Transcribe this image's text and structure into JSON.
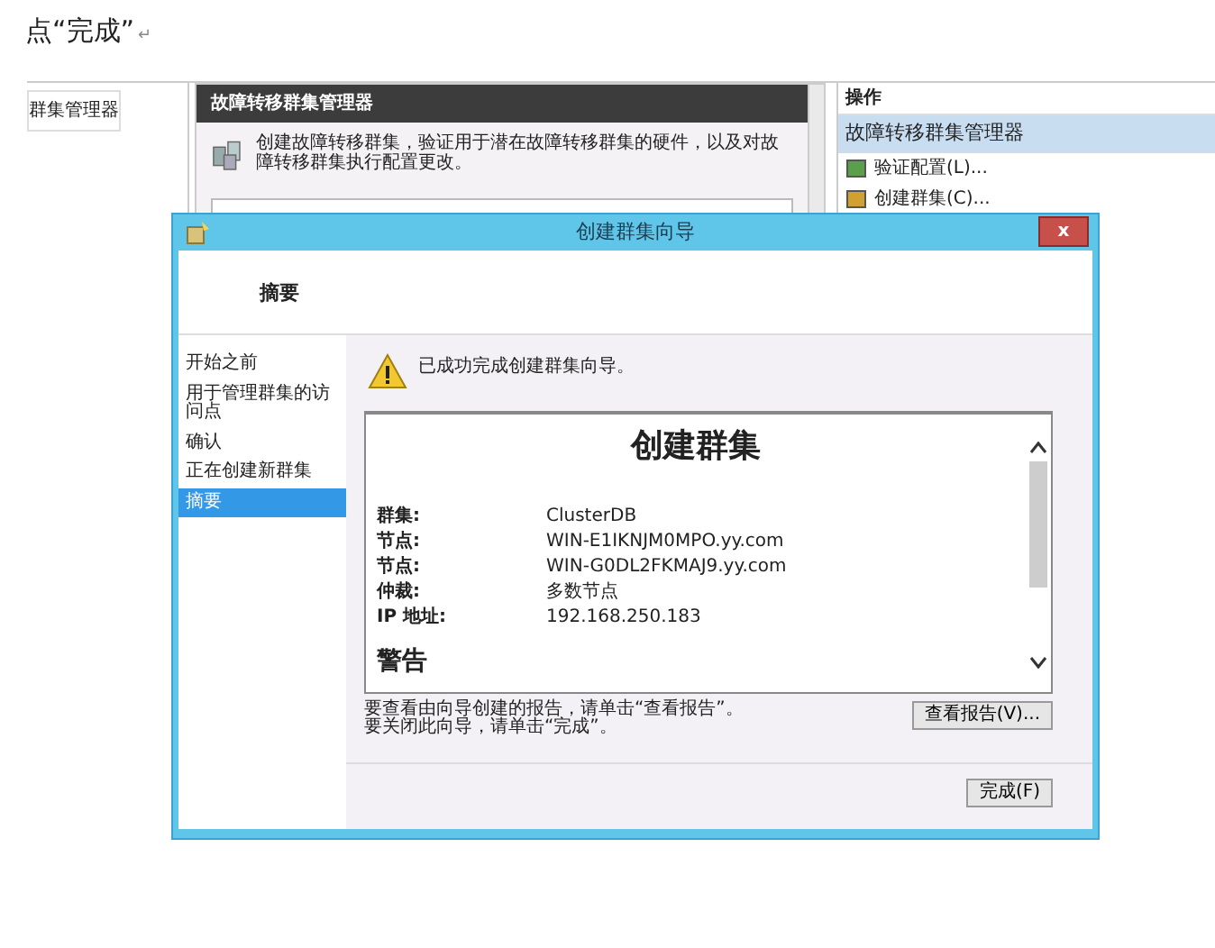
{
  "caption": {
    "text": "点“完成”",
    "paragraph_mark": "↵"
  },
  "background_window": {
    "tree_item": "群集管理器",
    "center": {
      "title": "故障转移群集管理器",
      "description": "创建故障转移群集，验证用于潜在故障转移群集的硬件，以及对故障转移群集执行配置更改。"
    },
    "actions": {
      "title": "操作",
      "section": "故障转移群集管理器",
      "items": [
        "验证配置(L)...",
        "创建群集(C)..."
      ]
    }
  },
  "dialog": {
    "title": "创建群集向导",
    "close_label": "x",
    "page_title": "摘要",
    "steps": [
      {
        "label": "开始之前",
        "selected": false
      },
      {
        "label": "用于管理群集的访问点",
        "selected": false
      },
      {
        "label": "确认",
        "selected": false
      },
      {
        "label": "正在创建新群集",
        "selected": false
      },
      {
        "label": "摘要",
        "selected": true
      }
    ],
    "message": "已成功完成创建群集向导。",
    "report": {
      "heading": "创建群集",
      "fields": [
        {
          "label": "群集:",
          "value": "ClusterDB"
        },
        {
          "label": "节点:",
          "value": "WIN-E1IKNJM0MPO.yy.com"
        },
        {
          "label": "节点:",
          "value": "WIN-G0DL2FKMAJ9.yy.com"
        },
        {
          "label": "仲裁:",
          "value": "多数节点"
        },
        {
          "label": "IP 地址:",
          "value": "192.168.250.183"
        }
      ],
      "section": "警告"
    },
    "hint_lines": [
      "要查看由向导创建的报告，请单击“查看报告”。",
      "要关闭此向导，请单击“完成”。"
    ],
    "buttons": [
      {
        "label": "查看报告(V)...",
        "kind": "view"
      },
      {
        "label": "完成(F)",
        "kind": "finish"
      }
    ]
  }
}
